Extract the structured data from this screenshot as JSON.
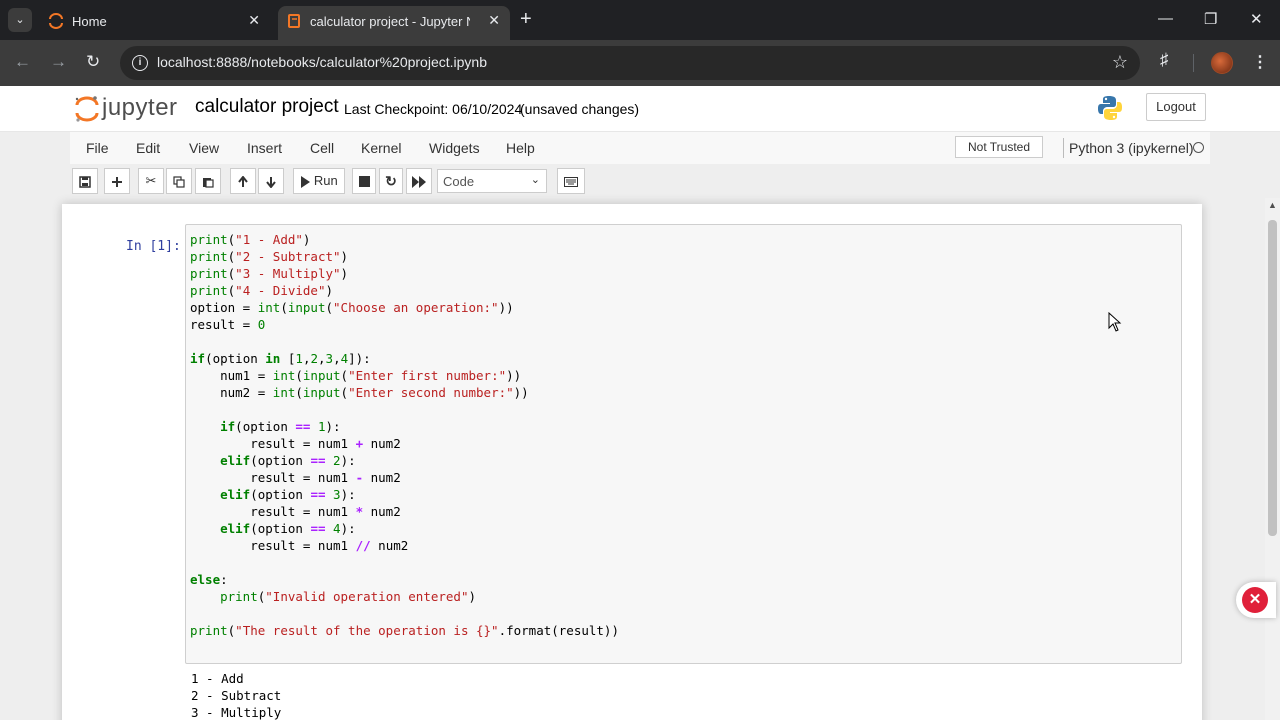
{
  "browser": {
    "tabs": [
      {
        "title": "Home",
        "active": false
      },
      {
        "title": "calculator project - Jupyter Notebook",
        "active": true
      }
    ],
    "url": "localhost:8888/notebooks/calculator%20project.ipynb"
  },
  "header": {
    "logo_text": "jupyter",
    "notebook_name": "calculator project",
    "checkpoint": "Last Checkpoint: 06/10/2024",
    "save_status": "(unsaved changes)",
    "logout_label": "Logout"
  },
  "menubar": {
    "items": [
      "File",
      "Edit",
      "View",
      "Insert",
      "Cell",
      "Kernel",
      "Widgets",
      "Help"
    ],
    "trust_label": "Not Trusted",
    "kernel_name": "Python 3 (ipykernel)"
  },
  "toolbar": {
    "run_label": "Run",
    "cell_type": "Code"
  },
  "cell": {
    "prompt": "In [1]:",
    "code_lines": [
      "print(\"1 - Add\")",
      "print(\"2 - Subtract\")",
      "print(\"3 - Multiply\")",
      "print(\"4 - Divide\")",
      "option = int(input(\"Choose an operation:\"))",
      "result = 0",
      "",
      "if(option in [1,2,3,4]):",
      "    num1 = int(input(\"Enter first number:\"))",
      "    num2 = int(input(\"Enter second number:\"))",
      "",
      "    if(option == 1):",
      "        result = num1 + num2",
      "    elif(option == 2):",
      "        result = num1 - num2",
      "    elif(option == 3):",
      "        result = num1 * num2",
      "    elif(option == 4):",
      "        result = num1 // num2",
      "",
      "else:",
      "    print(\"Invalid operation entered\")",
      "",
      "print(\"The result of the operation is {}\".format(result))"
    ],
    "output_lines": [
      "1 - Add",
      "2 - Subtract",
      "3 - Multiply"
    ]
  },
  "colors": {
    "keyword": "#008000",
    "string": "#ba2121",
    "operator": "#aa22ff",
    "prompt": "#303f9f"
  }
}
